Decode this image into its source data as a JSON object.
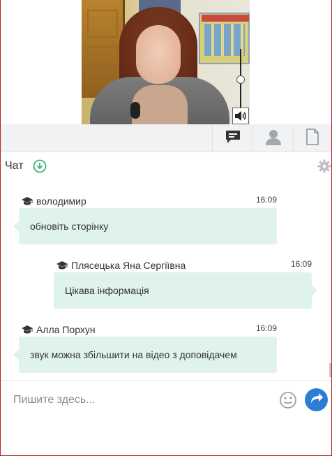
{
  "toolbar": {
    "tabs": [
      {
        "icon": "chat-bubble-icon",
        "active": true
      },
      {
        "icon": "user-icon",
        "active": false
      },
      {
        "icon": "document-icon",
        "active": false
      }
    ]
  },
  "chat": {
    "title": "Чат",
    "messages": [
      {
        "author": "володимир",
        "time": "16:09",
        "text": "обновіть сторінку",
        "side": "left"
      },
      {
        "author": "Плясецька Яна Сергіївна",
        "time": "16:09",
        "text": "Цікава інформація",
        "side": "right"
      },
      {
        "author": "Алла Порхун",
        "time": "16:09",
        "text": "звук можна збільшити на відео з доповідачем",
        "side": "left"
      }
    ]
  },
  "composer": {
    "placeholder": "Пишите здесь...",
    "value": ""
  },
  "colors": {
    "accent": "#2a7fd4",
    "bubble": "#dff3eb",
    "chat_icon_green": "#3bb27a",
    "toolbar_bg": "#f1f2f4"
  }
}
